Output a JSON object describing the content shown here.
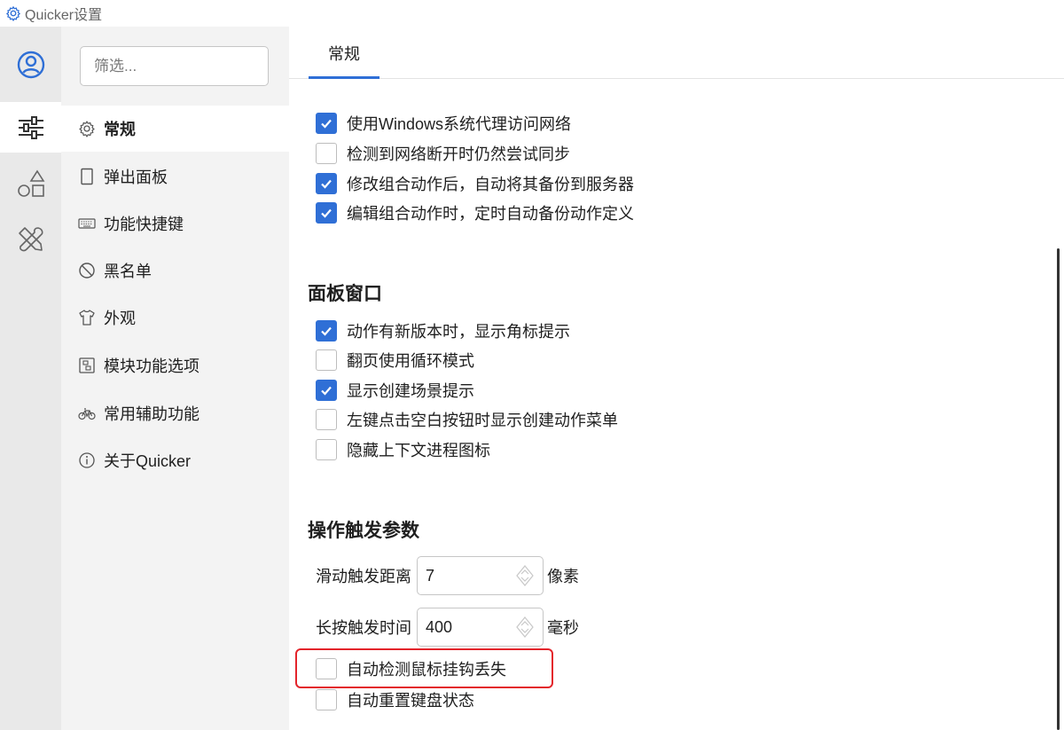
{
  "window": {
    "title": "Quicker设置"
  },
  "rail": {
    "items": [
      {
        "name": "account",
        "icon": "user-circle-icon",
        "active": false
      },
      {
        "name": "settings",
        "icon": "sliders-icon",
        "active": true
      },
      {
        "name": "shapes",
        "icon": "shapes-icon",
        "active": false
      },
      {
        "name": "tools",
        "icon": "tools-icon",
        "active": false
      }
    ]
  },
  "nav": {
    "filter_placeholder": "筛选...",
    "items": [
      {
        "label": "常规",
        "icon": "gear-icon",
        "active": true
      },
      {
        "label": "弹出面板",
        "icon": "panel-icon",
        "active": false
      },
      {
        "label": "功能快捷键",
        "icon": "keyboard-icon",
        "active": false
      },
      {
        "label": "黑名单",
        "icon": "block-icon",
        "active": false
      },
      {
        "label": "外观",
        "icon": "shirt-icon",
        "active": false
      },
      {
        "label": "模块功能选项",
        "icon": "module-icon",
        "active": false
      },
      {
        "label": "常用辅助功能",
        "icon": "bike-icon",
        "active": false
      },
      {
        "label": "关于Quicker",
        "icon": "info-icon",
        "active": false
      }
    ]
  },
  "main": {
    "tab_label": "常规",
    "network": [
      {
        "label": "使用Windows系统代理访问网络",
        "checked": true
      },
      {
        "label": "检测到网络断开时仍然尝试同步",
        "checked": false
      },
      {
        "label": "修改组合动作后，自动将其备份到服务器",
        "checked": true
      },
      {
        "label": "编辑组合动作时，定时自动备份动作定义",
        "checked": true
      }
    ],
    "panel_section": {
      "title": "面板窗口",
      "items": [
        {
          "label": "动作有新版本时，显示角标提示",
          "checked": true
        },
        {
          "label": "翻页使用循环模式",
          "checked": false
        },
        {
          "label": "显示创建场景提示",
          "checked": true
        },
        {
          "label": "左键点击空白按钮时显示创建动作菜单",
          "checked": false
        },
        {
          "label": "隐藏上下文进程图标",
          "checked": false
        }
      ]
    },
    "trigger_section": {
      "title": "操作触发参数",
      "swipe": {
        "label": "滑动触发距离",
        "value": "7",
        "unit": "像素"
      },
      "longpress": {
        "label": "长按触发时间",
        "value": "400",
        "unit": "毫秒"
      },
      "items": [
        {
          "label": "自动检测鼠标挂钩丢失",
          "checked": false
        },
        {
          "label": "自动重置键盘状态",
          "checked": false
        }
      ]
    }
  },
  "colors": {
    "accent": "#2f6fd6",
    "highlight": "#e3242b",
    "rail_bg": "#e9e9e9",
    "nav_bg": "#f3f3f3"
  }
}
